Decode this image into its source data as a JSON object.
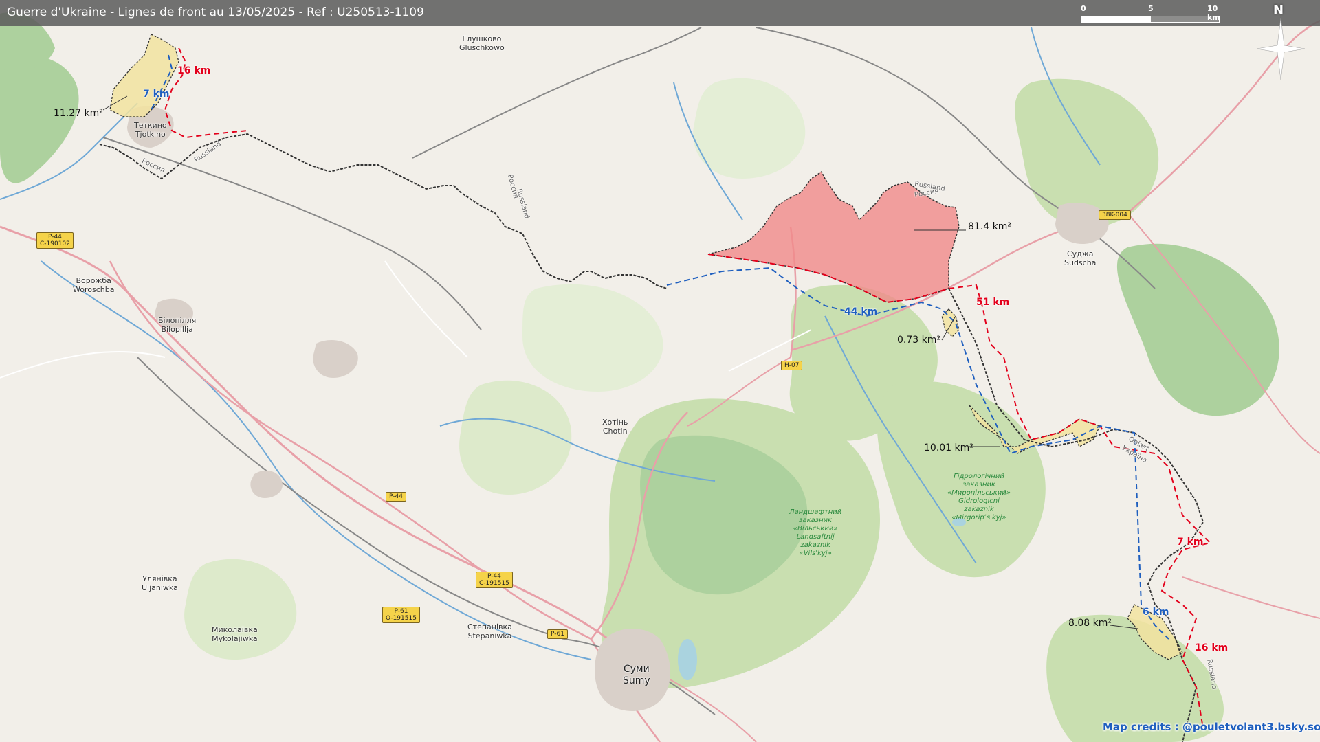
{
  "title": "Guerre d'Ukraine - Lignes de front au 13/05/2025 - Ref : U250513-1109",
  "scale": {
    "labels": [
      "0",
      "5",
      "10 km"
    ]
  },
  "north_label": "N",
  "places": [
    {
      "id": "gluschkowo",
      "lines": [
        "Глушково",
        "Gluschkowo"
      ]
    },
    {
      "id": "tetkino",
      "lines": [
        "Теткино",
        "Tjotkino"
      ]
    },
    {
      "id": "woroschba",
      "lines": [
        "Ворожба",
        "Woroschba"
      ]
    },
    {
      "id": "bilopillja",
      "lines": [
        "Білопілля",
        "Bilopillja"
      ]
    },
    {
      "id": "chotin",
      "lines": [
        "Хотінь",
        "Chotin"
      ]
    },
    {
      "id": "uljaniwka",
      "lines": [
        "Улянівка",
        "Uljaniwka"
      ]
    },
    {
      "id": "mykolajiwka",
      "lines": [
        "Миколаївка",
        "Mykolajiwka"
      ]
    },
    {
      "id": "stepaniwka",
      "lines": [
        "Степанівка",
        "Stepaniwka"
      ]
    },
    {
      "id": "sumy",
      "lines": [
        "Суми",
        "Sumy"
      ]
    },
    {
      "id": "sudscha",
      "lines": [
        "Суджа",
        "Sudscha"
      ]
    }
  ],
  "road_shields": [
    {
      "id": "p44-west",
      "lines": [
        "P-44",
        "C-190102"
      ]
    },
    {
      "id": "p44-mid",
      "lines": [
        "P-44"
      ]
    },
    {
      "id": "p44-south",
      "lines": [
        "P-44",
        "C-191515"
      ]
    },
    {
      "id": "p61",
      "lines": [
        "P-61",
        "O-191515"
      ]
    },
    {
      "id": "p61-sumy",
      "lines": [
        "P-61"
      ]
    },
    {
      "id": "h07",
      "lines": [
        "H-07"
      ]
    },
    {
      "id": "38k004",
      "lines": [
        "38K-004"
      ]
    }
  ],
  "border_labels": [
    "Russland",
    "Россия",
    "Russland",
    "Россия",
    "Russland",
    "Россия",
    "Україна",
    "Oblast",
    "Russland"
  ],
  "reserves": [
    {
      "id": "mirgorod",
      "lines": [
        "Гідрологічний",
        "заказник",
        "«Миропільський»",
        "Gidrologicni",
        "zakaznik",
        "«Mirgoripʼs'kyj»"
      ]
    },
    {
      "id": "vilnyi",
      "lines": [
        "Ландшафтний",
        "заказник",
        "«Вільський»",
        "Landsaftnij",
        "zakaznik",
        "«Vils'kyj»"
      ]
    }
  ],
  "areas": [
    {
      "id": "tetkino-area",
      "label": "11.27 km²"
    },
    {
      "id": "main-area",
      "label": "81.4 km²"
    },
    {
      "id": "small-area",
      "label": "0.73 km²"
    },
    {
      "id": "mid-area",
      "label": "10.01 km²"
    },
    {
      "id": "south-area",
      "label": "8.08 km²"
    }
  ],
  "distances": [
    {
      "id": "d16-north",
      "label": "16 km",
      "color": "red"
    },
    {
      "id": "d7-north",
      "label": "7 km",
      "color": "blue"
    },
    {
      "id": "d51",
      "label": "51 km",
      "color": "red"
    },
    {
      "id": "d44",
      "label": "44 km",
      "color": "blue"
    },
    {
      "id": "d7-east",
      "label": "7 km",
      "color": "red"
    },
    {
      "id": "d6",
      "label": "6 km",
      "color": "blue"
    },
    {
      "id": "d16-south",
      "label": "16 km",
      "color": "red"
    }
  ],
  "credits": "Map credits : @pouletvolant3.bsky.social",
  "colors": {
    "background": "#f2efe9",
    "forest": "#c9dfb0",
    "woodland": "#add19e",
    "water": "#aad3df",
    "river": "#6fa8d6",
    "primary_road": "#e8a0a8",
    "minor_road": "#ffffff",
    "railway": "#888888",
    "occupied_fill": "#f08a8a",
    "contested_fill": "#f2e3a0",
    "front_red": "#e3001b",
    "front_blue": "#1f5fbf",
    "border": "#333333"
  }
}
